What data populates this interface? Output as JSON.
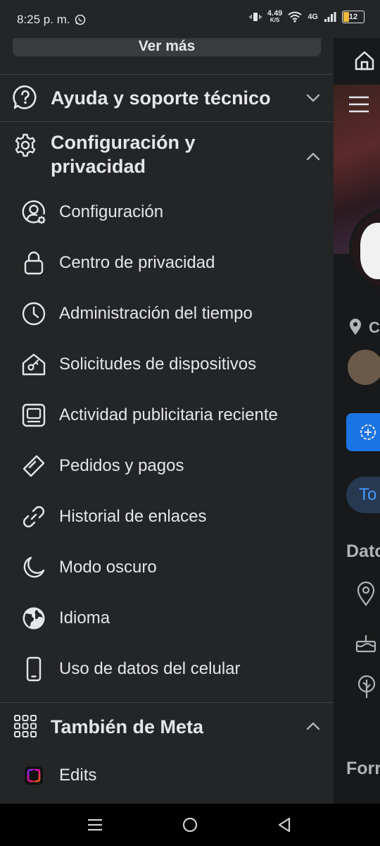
{
  "status_bar": {
    "time": "8:25 p. m.",
    "net_speed_top": "4.49",
    "net_speed_unit": "K/S",
    "network": "4G",
    "battery": "12"
  },
  "drawer": {
    "see_more_label": "Ver más",
    "help_label": "Ayuda y soporte técnico",
    "settings_section_label_line1": "Configuración y",
    "settings_section_label_line2": "privacidad",
    "settings_items": [
      {
        "label": "Configuración",
        "icon": "user-gear-icon"
      },
      {
        "label": "Centro de privacidad",
        "icon": "lock-icon"
      },
      {
        "label": "Administración del tiempo",
        "icon": "clock-icon"
      },
      {
        "label": "Solicitudes de dispositivos",
        "icon": "home-key-icon"
      },
      {
        "label": "Actividad publicitaria reciente",
        "icon": "ad-monitor-icon"
      },
      {
        "label": "Pedidos y pagos",
        "icon": "tag-icon"
      },
      {
        "label": "Historial de enlaces",
        "icon": "link-icon"
      },
      {
        "label": "Modo oscuro",
        "icon": "moon-icon"
      },
      {
        "label": "Idioma",
        "icon": "globe-icon"
      },
      {
        "label": "Uso de datos del celular",
        "icon": "phone-icon"
      }
    ],
    "meta_section_label": "También de Meta",
    "meta_items": [
      {
        "label": "Edits",
        "icon": "edits-app-icon"
      }
    ]
  },
  "background_page": {
    "location_text": "C",
    "tab_text": "To",
    "section_title": "Dato",
    "footer_title": "Forr"
  },
  "colors": {
    "drawer_bg": "#242526",
    "page_bg": "#18191a",
    "text": "#e4e6eb",
    "accent": "#1b74e4"
  }
}
